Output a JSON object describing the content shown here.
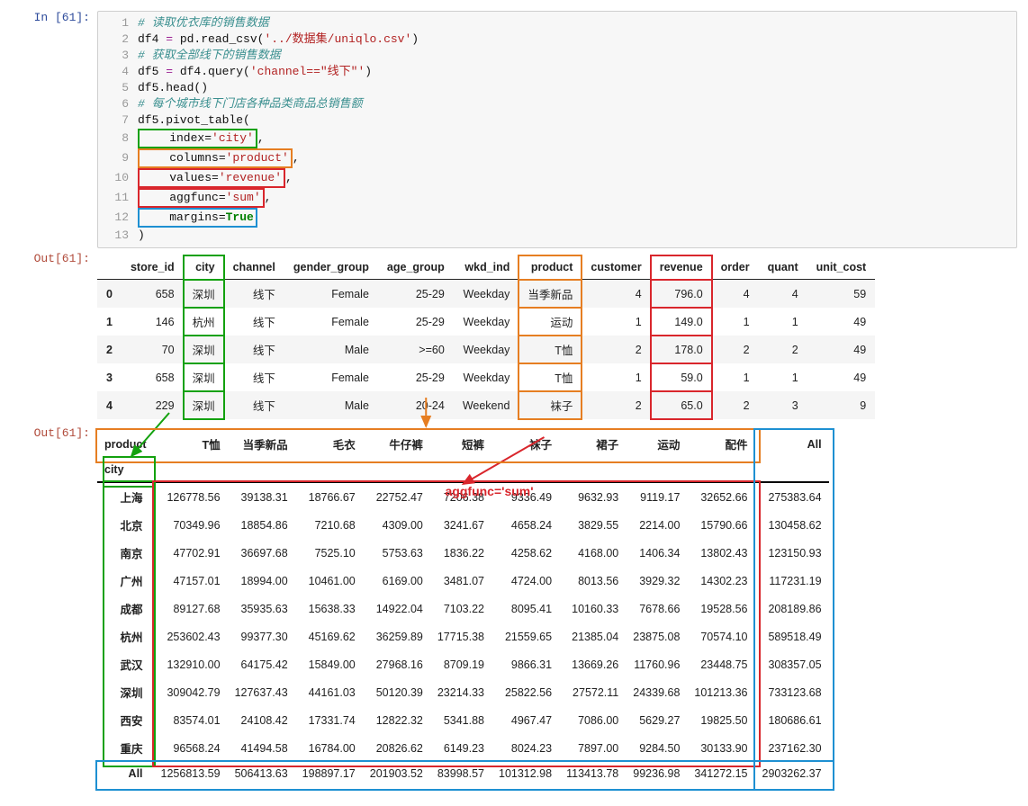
{
  "cell": {
    "in_label": "In [61]:",
    "out_label": "Out[61]:",
    "lines": {
      "l1": "# 读取优衣库的销售数据",
      "l2_a": "df4 ",
      "l2_b": "=",
      "l2_c": " pd.read_csv(",
      "l2_d": "'../数据集/uniqlo.csv'",
      "l2_e": ")",
      "l3": "# 获取全部线下的销售数据",
      "l4_a": "df5 ",
      "l4_b": "=",
      "l4_c": " df4.query(",
      "l4_d": "'channel==\"线下\"'",
      "l4_e": ")",
      "l5": "df5.head()",
      "l6": "# 每个城市线下门店各种品类商品总销售额",
      "l7": "df5.pivot_table(",
      "l8_a": "    index=",
      "l8_b": "'city'",
      "l8_c": ",",
      "l9_a": "    columns=",
      "l9_b": "'product'",
      "l9_c": ",",
      "l10_a": "    values=",
      "l10_b": "'revenue'",
      "l10_c": ",",
      "l11_a": "    aggfunc=",
      "l11_b": "'sum'",
      "l11_c": ",",
      "l12_a": "    margins=",
      "l12_b": "True",
      "l13": ")"
    }
  },
  "table1": {
    "headers": [
      "store_id",
      "city",
      "channel",
      "gender_group",
      "age_group",
      "wkd_ind",
      "product",
      "customer",
      "revenue",
      "order",
      "quant",
      "unit_cost"
    ],
    "rows": [
      {
        "idx": "0",
        "cells": [
          "658",
          "深圳",
          "线下",
          "Female",
          "25-29",
          "Weekday",
          "当季新品",
          "4",
          "796.0",
          "4",
          "4",
          "59"
        ]
      },
      {
        "idx": "1",
        "cells": [
          "146",
          "杭州",
          "线下",
          "Female",
          "25-29",
          "Weekday",
          "运动",
          "1",
          "149.0",
          "1",
          "1",
          "49"
        ]
      },
      {
        "idx": "2",
        "cells": [
          "70",
          "深圳",
          "线下",
          "Male",
          ">=60",
          "Weekday",
          "T恤",
          "2",
          "178.0",
          "2",
          "2",
          "49"
        ]
      },
      {
        "idx": "3",
        "cells": [
          "658",
          "深圳",
          "线下",
          "Female",
          "25-29",
          "Weekday",
          "T恤",
          "1",
          "59.0",
          "1",
          "1",
          "49"
        ]
      },
      {
        "idx": "4",
        "cells": [
          "229",
          "深圳",
          "线下",
          "Male",
          "20-24",
          "Weekend",
          "袜子",
          "2",
          "65.0",
          "2",
          "3",
          "9"
        ]
      }
    ]
  },
  "pivot": {
    "colheader": "product",
    "rowheader": "city",
    "cols": [
      "T恤",
      "当季新品",
      "毛衣",
      "牛仔裤",
      "短裤",
      "袜子",
      "裙子",
      "运动",
      "配件",
      "All"
    ],
    "rows": [
      {
        "label": "上海",
        "v": [
          "126778.56",
          "39138.31",
          "18766.67",
          "22752.47",
          "7206.38",
          "9336.49",
          "9632.93",
          "9119.17",
          "32652.66",
          "275383.64"
        ]
      },
      {
        "label": "北京",
        "v": [
          "70349.96",
          "18854.86",
          "7210.68",
          "4309.00",
          "3241.67",
          "4658.24",
          "3829.55",
          "2214.00",
          "15790.66",
          "130458.62"
        ]
      },
      {
        "label": "南京",
        "v": [
          "47702.91",
          "36697.68",
          "7525.10",
          "5753.63",
          "1836.22",
          "4258.62",
          "4168.00",
          "1406.34",
          "13802.43",
          "123150.93"
        ]
      },
      {
        "label": "广州",
        "v": [
          "47157.01",
          "18994.00",
          "10461.00",
          "6169.00",
          "3481.07",
          "4724.00",
          "8013.56",
          "3929.32",
          "14302.23",
          "117231.19"
        ]
      },
      {
        "label": "成都",
        "v": [
          "89127.68",
          "35935.63",
          "15638.33",
          "14922.04",
          "7103.22",
          "8095.41",
          "10160.33",
          "7678.66",
          "19528.56",
          "208189.86"
        ]
      },
      {
        "label": "杭州",
        "v": [
          "253602.43",
          "99377.30",
          "45169.62",
          "36259.89",
          "17715.38",
          "21559.65",
          "21385.04",
          "23875.08",
          "70574.10",
          "589518.49"
        ]
      },
      {
        "label": "武汉",
        "v": [
          "132910.00",
          "64175.42",
          "15849.00",
          "27968.16",
          "8709.19",
          "9866.31",
          "13669.26",
          "11760.96",
          "23448.75",
          "308357.05"
        ]
      },
      {
        "label": "深圳",
        "v": [
          "309042.79",
          "127637.43",
          "44161.03",
          "50120.39",
          "23214.33",
          "25822.56",
          "27572.11",
          "24339.68",
          "101213.36",
          "733123.68"
        ]
      },
      {
        "label": "西安",
        "v": [
          "83574.01",
          "24108.42",
          "17331.74",
          "12822.32",
          "5341.88",
          "4967.47",
          "7086.00",
          "5629.27",
          "19825.50",
          "180686.61"
        ]
      },
      {
        "label": "重庆",
        "v": [
          "96568.24",
          "41494.58",
          "16784.00",
          "20826.62",
          "6149.23",
          "8024.23",
          "7897.00",
          "9284.50",
          "30133.90",
          "237162.30"
        ]
      }
    ],
    "footer": {
      "label": "All",
      "v": [
        "1256813.59",
        "506413.63",
        "198897.17",
        "201903.52",
        "83998.57",
        "101312.98",
        "113413.78",
        "99236.98",
        "341272.15",
        "2903262.37"
      ]
    },
    "annotation": "aggfunc='sum'"
  }
}
